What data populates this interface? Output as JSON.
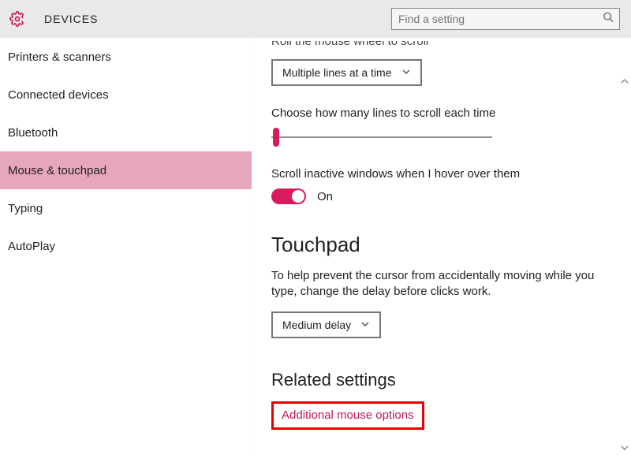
{
  "header": {
    "title": "DEVICES",
    "search_placeholder": "Find a setting"
  },
  "sidebar": {
    "items": [
      {
        "label": "Printers & scanners"
      },
      {
        "label": "Connected devices"
      },
      {
        "label": "Bluetooth"
      },
      {
        "label": "Mouse & touchpad"
      },
      {
        "label": "Typing"
      },
      {
        "label": "AutoPlay"
      }
    ],
    "active_index": 3
  },
  "content": {
    "scroll_label": "Roll the mouse wheel to scroll",
    "scroll_dropdown": "Multiple lines at a time",
    "lines_label": "Choose how many lines to scroll each time",
    "inactive_label": "Scroll inactive windows when I hover over them",
    "toggle_value": "On",
    "touchpad_heading": "Touchpad",
    "touchpad_desc": "To help prevent the cursor from accidentally moving while you type, change the delay before clicks work.",
    "delay_dropdown": "Medium delay",
    "related_heading": "Related settings",
    "related_link": "Additional mouse options"
  }
}
